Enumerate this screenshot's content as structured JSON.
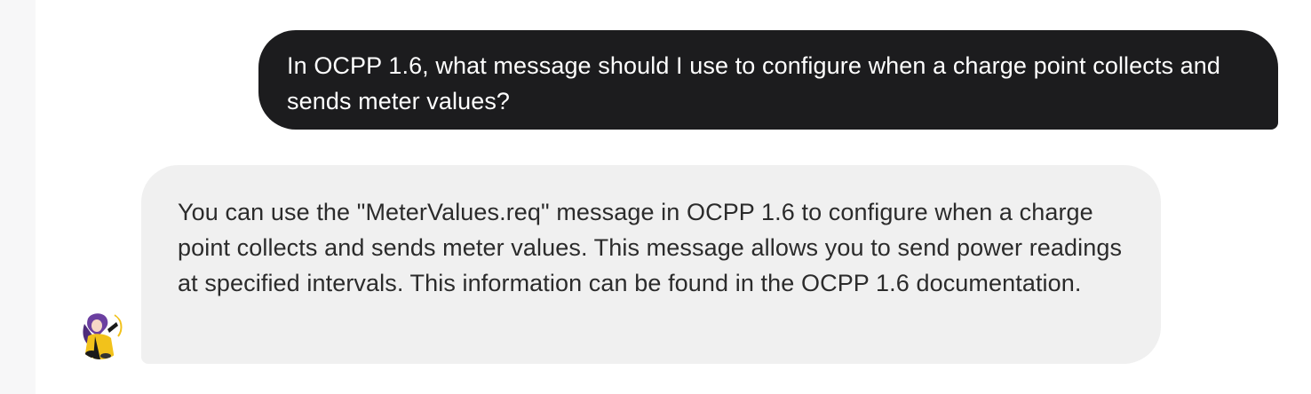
{
  "messages": [
    {
      "role": "user",
      "text": "In OCPP 1.6, what message should I use to configure when a charge point collects and sends meter values?"
    },
    {
      "role": "assistant",
      "text": "You can use the \"MeterValues.req\" message in OCPP 1.6 to configure when a charge point collects and sends meter values. This message allows you to send power readings at specified intervals. This information can be found in the OCPP 1.6 documentation."
    }
  ],
  "avatar": {
    "icon": "character-avatar-icon",
    "colors": {
      "hair": "#6b3fa0",
      "jacket": "#f2c21b",
      "dark": "#1a1a1a"
    }
  },
  "colors": {
    "user_bubble": "#1c1c1e",
    "assistant_bubble": "#f0f0f0",
    "gutter": "#f7f7f8"
  }
}
